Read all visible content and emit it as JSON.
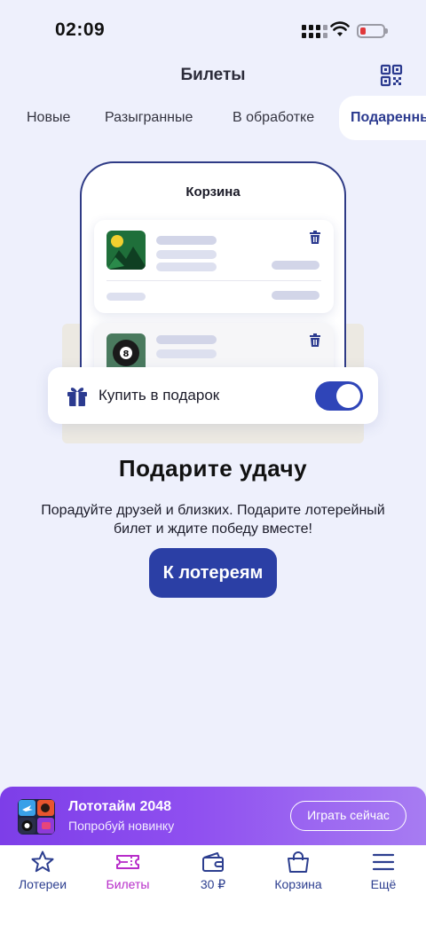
{
  "status_bar": {
    "time": "02:09"
  },
  "header": {
    "title": "Билеты",
    "qr_icon": "qr-code-icon"
  },
  "tabs": [
    {
      "label": "Новые"
    },
    {
      "label": "Разыгранные"
    },
    {
      "label": "В обработке"
    },
    {
      "label": "Подаренные",
      "active": true
    }
  ],
  "illustration": {
    "cart_title": "Корзина",
    "gift_option_label": "Купить в подарок",
    "gift_option_enabled": true
  },
  "promo": {
    "headline": "Подарите удачу",
    "description": "Порадуйте друзей и близких. Подарите лотерейный билет и ждите победу вместе!",
    "cta_label": "К лотереям"
  },
  "banner": {
    "title": "Лототайм 2048",
    "subtitle": "Попробуй новинку",
    "button_label": "Играть сейчас"
  },
  "bottom_nav": [
    {
      "label": "Лотереи",
      "icon": "star-icon"
    },
    {
      "label": "Билеты",
      "icon": "ticket-icon",
      "active": true
    },
    {
      "label": "30 ₽",
      "icon": "wallet-icon"
    },
    {
      "label": "Корзина",
      "icon": "shopping-bag-icon"
    },
    {
      "label": "Ещё",
      "icon": "menu-icon"
    }
  ],
  "colors": {
    "background": "#eef0fc",
    "primary": "#2b3fa5",
    "nav_active": "#b72cc9",
    "banner_gradient_start": "#7d3ee8",
    "banner_gradient_end": "#a77cf2"
  }
}
